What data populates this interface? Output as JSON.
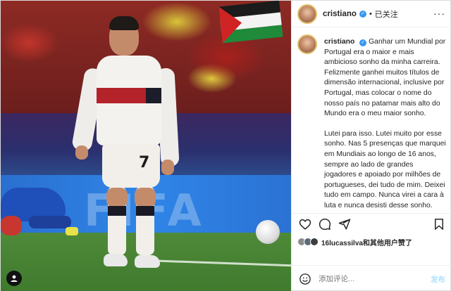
{
  "header": {
    "username": "cristiano",
    "follow_status": "已关注",
    "more": "···"
  },
  "caption": {
    "username": "cristiano",
    "paragraphs": [
      "Ganhar um Mundial por Portugal era o maior e mais ambicioso sonho da minha carreira. Felizmente ganhei muitos títulos de dimensão internacional, inclusive por Portugal, mas colocar o nome do nosso país no patamar mais alto do Mundo era o meu maior sonho.",
      "Lutei para isso. Lutei muito por esse sonho. Nas 5 presenças que marquei em Mundiais ao longo de 16 anos, sempre ao lado de grandes jogadores e apoiado por milhões de portugueses, dei tudo de mim. Deixei tudo em campo. Nunca virei a cara à luta e nunca desisti desse sonho."
    ]
  },
  "likes": {
    "text": "16lucassilva和其他用户赞了"
  },
  "comment": {
    "placeholder": "添加评论...",
    "post_label": "发布"
  },
  "photo": {
    "jersey_number": "7",
    "hoarding_text": "FIFA"
  },
  "icons": [
    "heart-icon",
    "comment-icon",
    "share-icon",
    "bookmark-icon",
    "emoji-icon",
    "user-tag-icon",
    "verified-icon"
  ],
  "colors": {
    "verified": "#3897f0",
    "post_button": "#b2dffc",
    "text": "#262626",
    "muted": "#8e8e8e"
  }
}
